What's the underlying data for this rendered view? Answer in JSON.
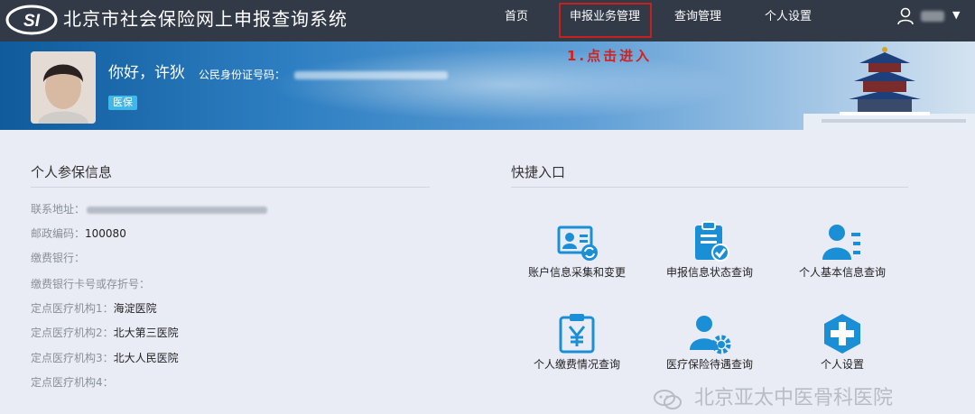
{
  "header": {
    "system_title": "北京市社会保险网上申报查询系统",
    "logo_text": "SI",
    "nav": {
      "home": "首页",
      "report_management": "申报业务管理",
      "query_management": "查询管理",
      "personal_settings": "个人设置"
    },
    "caret": "▼"
  },
  "banner": {
    "annotation": "1.点击进入",
    "greeting": "你好，许狄",
    "id_label": "公民身份证号码：",
    "badge": "医保"
  },
  "personal_info": {
    "title": "个人参保信息",
    "rows": [
      {
        "label": "联系地址：",
        "value": ""
      },
      {
        "label": "邮政编码：",
        "value": "100080"
      },
      {
        "label": "缴费银行：",
        "value": ""
      },
      {
        "label": "缴费银行卡号或存折号：",
        "value": ""
      },
      {
        "label": "定点医疗机构1：",
        "value": "海淀医院"
      },
      {
        "label": "定点医疗机构2：",
        "value": "北大第三医院"
      },
      {
        "label": "定点医疗机构3：",
        "value": "北大人民医院"
      },
      {
        "label": "定点医疗机构4：",
        "value": ""
      }
    ]
  },
  "shortcuts": {
    "title": "快捷入口",
    "items": [
      {
        "label": "账户信息采集和变更",
        "icon": "id-card-icon"
      },
      {
        "label": "申报信息状态查询",
        "icon": "clipboard-check-icon"
      },
      {
        "label": "个人基本信息查询",
        "icon": "person-list-icon"
      },
      {
        "label": "个人缴费情况查询",
        "icon": "yen-clipboard-icon"
      },
      {
        "label": "医疗保险待遇查询",
        "icon": "person-gear-icon"
      },
      {
        "label": "个人设置",
        "icon": "plus-hexagon-icon"
      }
    ]
  },
  "watermark": "北京亚太中医骨科医院",
  "colors": {
    "header_bg": "#323a48",
    "accent_blue": "#1a8fd6",
    "highlight_red": "#c8201e",
    "badge": "#3fb7e8",
    "page_bg": "#e9ecf5"
  }
}
